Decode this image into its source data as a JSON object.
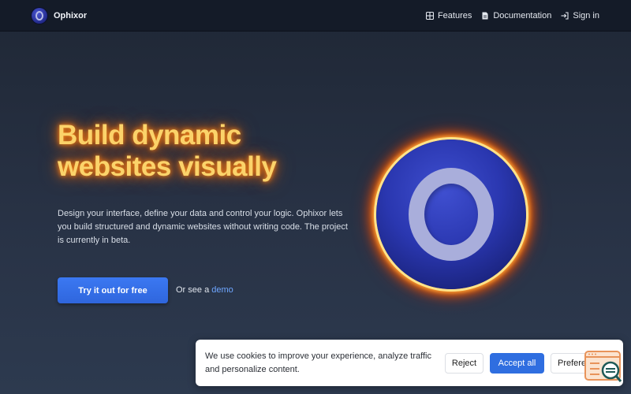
{
  "nav": {
    "brand": "Ophixor",
    "links": [
      {
        "label": "Features",
        "icon": "grid-icon"
      },
      {
        "label": "Documentation",
        "icon": "document-icon"
      },
      {
        "label": "Sign in",
        "icon": "sign-in-icon"
      }
    ]
  },
  "hero": {
    "title_line1": "Build dynamic",
    "title_line2": "websites visually",
    "description": "Design your interface, define your data and control your logic. Ophixor lets you build structured and dynamic websites without writing code. The project is currently in beta.",
    "cta_label": "Try it out for free",
    "demo_prefix": "Or see a",
    "demo_link": "demo"
  },
  "cookie": {
    "message": "We use cookies to improve your experience, analyze traffic and personalize content.",
    "reject_label": "Reject",
    "accept_label": "Accept all",
    "preferences_label": "Preferences"
  },
  "colors": {
    "accent": "#2f6ee0",
    "title_glow": "#ff6a00",
    "logo_blue": "#2a37b0"
  }
}
